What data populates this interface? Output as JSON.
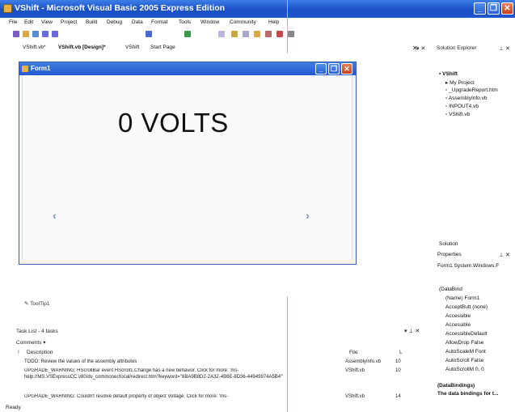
{
  "window": {
    "title": "VShift - Microsoft Visual Basic 2005 Express Edition",
    "controls": [
      "_",
      "❐",
      "✕"
    ]
  },
  "menu": [
    "File",
    "Edit",
    "View",
    "Project",
    "Build",
    "Debug",
    "Data",
    "Format",
    "Tools",
    "Window",
    "Community",
    "Help"
  ],
  "tabs": [
    "VShift.vb*",
    "VShift.vb [Design]*",
    "VShift",
    "Start Page"
  ],
  "form": {
    "title": "Form1",
    "label_text": "0 VOLTS",
    "scroll_left": "‹",
    "scroll_right": "›"
  },
  "tooltip_tray": "ToolTip1",
  "task_list": {
    "title": "Task List - 4 tasks",
    "filter": "Comments",
    "col_bang": "!",
    "col_description": "Description",
    "col_file": "File",
    "col_line": "L",
    "rows": [
      {
        "desc": "TODO: Review the values of the assembly attributes",
        "file": "AssemblyInfo.vb",
        "line": "10"
      },
      {
        "desc": "UPGRADE_WARNING: HScrollBar event HScroll1.Change has a new behavior. Click for more: 'ms-help://MS.VSExpressCC.v80/dv_commoner/local/redirect.htm?keyword=\"6BA9B8D2-2A32-4B6E-8D36-44949974A5B4\"'",
        "file": "VShift.vb",
        "line": "10"
      },
      {
        "desc": "UPGRADE_WARNING: Couldn't resolve default property of object Voltage. Click for more: 'ms-",
        "file": "VShift.vb",
        "line": "14"
      }
    ]
  },
  "status": "Ready",
  "solution_explorer": {
    "title": "Solution Explorer",
    "items": [
      "VShift",
      "My Project",
      "_UpgradeReport.htm",
      "AssemblyInfo.vb",
      "INPOUT4.vb",
      "VShift.vb"
    ],
    "bottom_tab": "Solution"
  },
  "properties": {
    "title": "Properties",
    "object": "Form1 System.Windows.F",
    "rows": [
      "(DataBind",
      "(Name)    Form1",
      "AcceptButt (none)",
      "Accessible",
      "Accessible",
      "AccessibleDefault",
      "AllowDrop False",
      "AutoScaleM Font",
      "AutoScroll False",
      "AutoScrollM 0, 0"
    ],
    "desc_title": "(DataBindings)",
    "desc_text": "The data bindings for t..."
  },
  "colors": {
    "title_bar": "#1f56cc",
    "form_title": "#3f7de0",
    "accent": "#d9a0d8"
  }
}
